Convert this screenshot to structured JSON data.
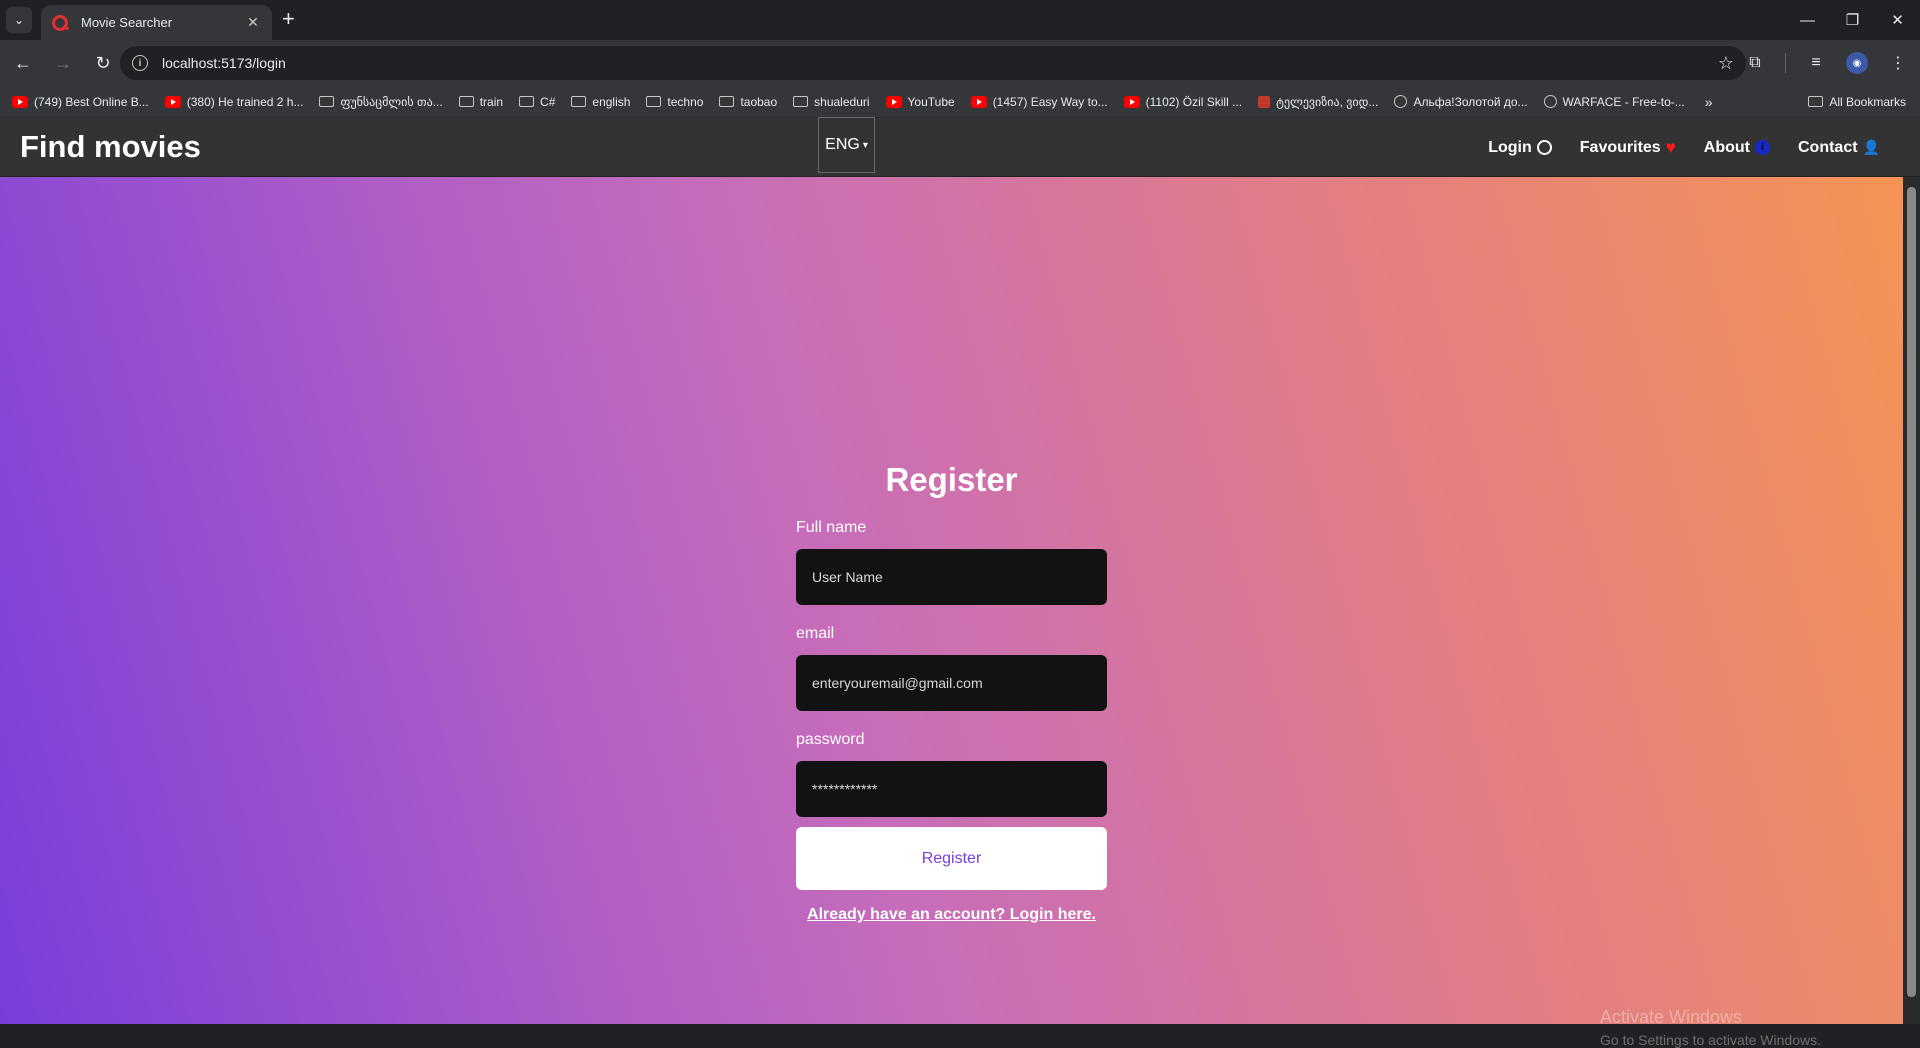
{
  "browser": {
    "tab_title": "Movie Searcher",
    "url": "localhost:5173/login",
    "bookmarks": [
      {
        "label": "(749) Best Online B...",
        "icon": "youtube-icon"
      },
      {
        "label": "(380) He trained 2 h...",
        "icon": "youtube-icon"
      },
      {
        "label": "ფუნსაცმლის თა...",
        "icon": "folder-icon"
      },
      {
        "label": "train",
        "icon": "folder-icon"
      },
      {
        "label": "C#",
        "icon": "folder-icon"
      },
      {
        "label": "english",
        "icon": "folder-icon"
      },
      {
        "label": "techno",
        "icon": "folder-icon"
      },
      {
        "label": "taobao",
        "icon": "folder-icon"
      },
      {
        "label": "shualeduri",
        "icon": "folder-icon"
      },
      {
        "label": "YouTube",
        "icon": "youtube-icon"
      },
      {
        "label": "(1457) Easy Way to...",
        "icon": "youtube-icon"
      },
      {
        "label": "(1102) Özil Skill ...",
        "icon": "youtube-icon"
      },
      {
        "label": "ტელევიზია, ვიდ...",
        "icon": "red-site-icon"
      },
      {
        "label": "Альфа!Золотой до...",
        "icon": "globe-icon"
      },
      {
        "label": "WARFACE - Free-to-...",
        "icon": "globe-icon"
      }
    ],
    "all_bookmarks": "All Bookmarks"
  },
  "navbar": {
    "brand": "Find movies",
    "language": "ENG",
    "links": {
      "login": "Login",
      "favourites": "Favourites",
      "about": "About",
      "contact": "Contact"
    }
  },
  "form": {
    "title": "Register",
    "fullname_label": "Full name",
    "fullname_placeholder": "User Name",
    "email_label": "email",
    "email_placeholder": "enteryouremail@gmail.com",
    "password_label": "password",
    "password_placeholder": "************",
    "submit_label": "Register",
    "login_link": "Already have an account? Login here."
  },
  "watermark": {
    "line1": "Activate Windows",
    "line2": "Go to Settings to activate Windows."
  },
  "colors": {
    "gradient_start": "#7a3ddb",
    "gradient_end": "#f69354",
    "navbar_bg": "#333333",
    "input_bg": "#121212",
    "button_text": "#7a3ddb"
  }
}
